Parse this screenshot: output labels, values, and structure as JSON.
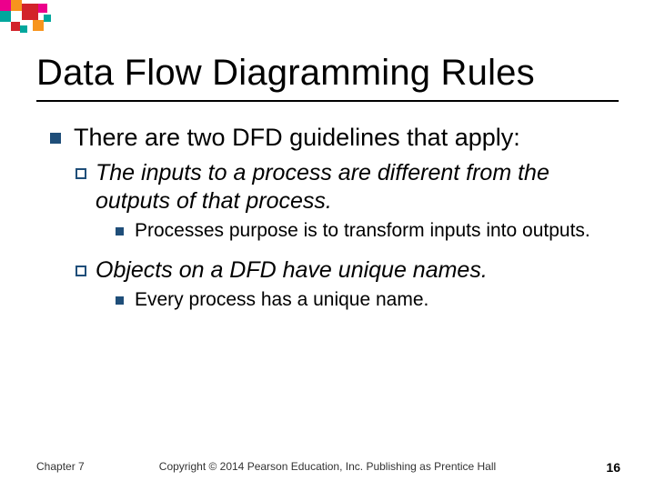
{
  "title": "Data Flow Diagramming Rules",
  "bullets": {
    "l1_0": "There are two DFD guidelines that apply:",
    "l2_0": "The inputs to a process are different from the outputs of that process.",
    "l3_0": "Processes purpose is to transform inputs into outputs.",
    "l2_1": "Objects on a DFD have unique names.",
    "l3_1": "Every process has a unique name."
  },
  "footer": {
    "left": "Chapter 7",
    "center": "Copyright © 2014 Pearson Education, Inc. Publishing as Prentice Hall",
    "right": "16"
  },
  "decor_colors": {
    "pink": "#EC008C",
    "orange": "#F7941D",
    "red": "#D2232A",
    "teal": "#00A79D"
  }
}
